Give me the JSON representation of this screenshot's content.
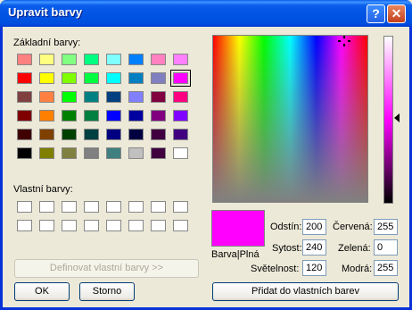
{
  "window": {
    "title": "Upravit barvy",
    "help_glyph": "?",
    "close_glyph": "✕"
  },
  "basic_colors": {
    "label": "Základní barvy:",
    "rows": [
      [
        "#FF8080",
        "#FFFF80",
        "#80FF80",
        "#00FF80",
        "#80FFFF",
        "#0080FF",
        "#FF80C0",
        "#FF80FF"
      ],
      [
        "#FF0000",
        "#FFFF00",
        "#80FF00",
        "#00FF40",
        "#00FFFF",
        "#0080C0",
        "#8080C0",
        "#FF00FF"
      ],
      [
        "#804040",
        "#FF8040",
        "#00FF00",
        "#008080",
        "#004080",
        "#8080FF",
        "#800040",
        "#FF0080"
      ],
      [
        "#800000",
        "#FF8000",
        "#008000",
        "#008040",
        "#0000FF",
        "#0000A0",
        "#800080",
        "#8000FF"
      ],
      [
        "#400000",
        "#804000",
        "#004000",
        "#004040",
        "#000080",
        "#000040",
        "#400040",
        "#400080"
      ],
      [
        "#000000",
        "#808000",
        "#808040",
        "#808080",
        "#408080",
        "#C0C0C0",
        "#400040",
        "#FFFFFF"
      ]
    ],
    "selected_color": "#FF00FF"
  },
  "custom_colors": {
    "label": "Vlastní barvy:",
    "count": 16
  },
  "buttons": {
    "define": "Definovat vlastní barvy >>",
    "ok": "OK",
    "cancel": "Storno",
    "add": "Přidat do vlastních barev"
  },
  "preview": {
    "label": "Barva|Plná",
    "color": "#FF00FF"
  },
  "fields": {
    "hue": {
      "label": "Odstín:",
      "value": "200"
    },
    "sat": {
      "label": "Sytost:",
      "value": "240"
    },
    "lum": {
      "label": "Světelnost:",
      "value": "120"
    },
    "red": {
      "label": "Červená:",
      "value": "255"
    },
    "green": {
      "label": "Zelená:",
      "value": "0"
    },
    "blue": {
      "label": "Modrá:",
      "value": "255"
    }
  }
}
